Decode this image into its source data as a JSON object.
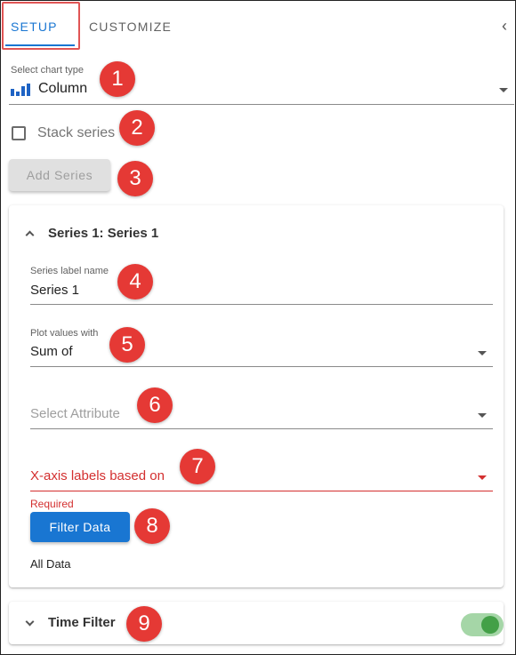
{
  "tabs": [
    {
      "label": "SETUP",
      "active": true
    },
    {
      "label": "CUSTOMIZE",
      "active": false
    }
  ],
  "collapse_icon": "chevron-left-icon",
  "chart_type": {
    "label": "Select chart type",
    "value": "Column",
    "icon": "column-chart-icon"
  },
  "stack_series": {
    "label": "Stack series",
    "checked": false
  },
  "add_series_label": "Add Series",
  "series_panel": {
    "title": "Series 1: Series 1",
    "expanded": true,
    "label_name": {
      "label": "Series label name",
      "value": "Series 1"
    },
    "plot_values": {
      "label": "Plot values with",
      "value": "Sum of"
    },
    "attribute": {
      "placeholder": "Select Attribute"
    },
    "xaxis": {
      "placeholder": "X-axis labels based on",
      "helper": "Required"
    },
    "filter_button": "Filter Data",
    "filter_summary": "All Data"
  },
  "time_filter": {
    "title": "Time Filter",
    "expanded": false,
    "enabled": true
  },
  "markers": [
    "1",
    "2",
    "3",
    "4",
    "5",
    "6",
    "7",
    "8",
    "9"
  ],
  "colors": {
    "accent": "#1976d2",
    "error": "#d32f2f",
    "marker": "#e53935",
    "toggle_on": "#43a047"
  }
}
